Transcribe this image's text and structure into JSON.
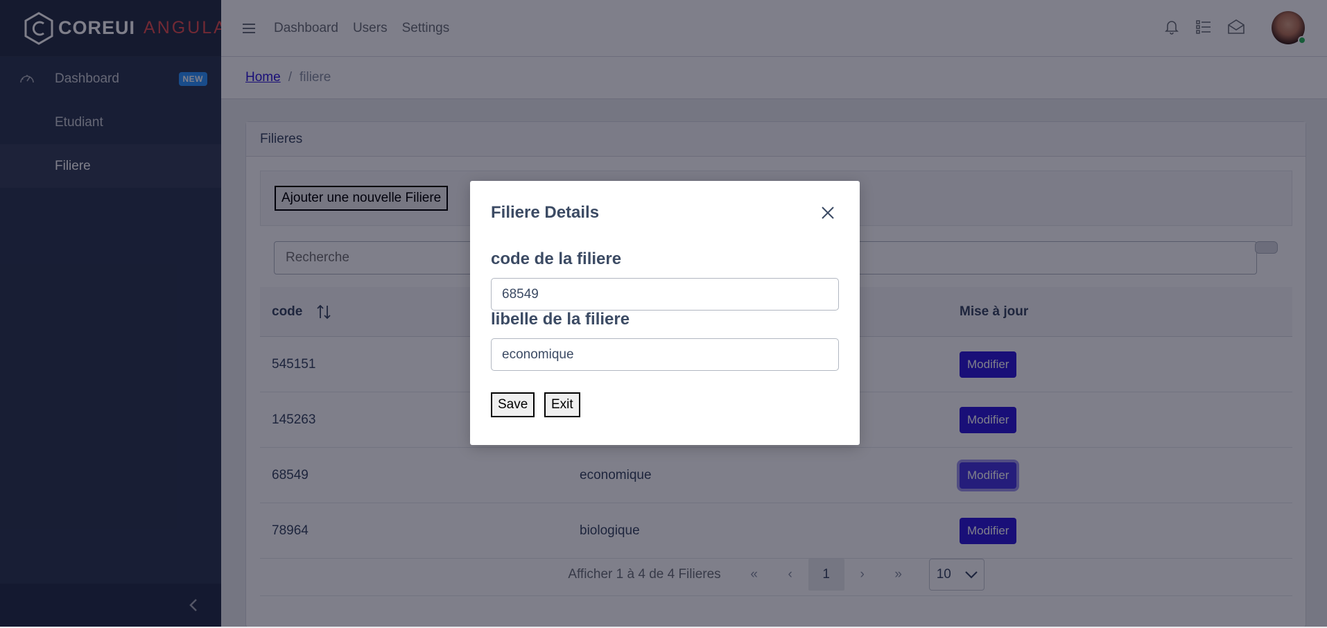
{
  "brand": {
    "part_a": "COREUI",
    "part_b": "ANGULAR"
  },
  "sidebar": {
    "items": [
      {
        "label": "Dashboard",
        "badge": "NEW",
        "icon": "speedometer-icon"
      },
      {
        "label": "Etudiant"
      },
      {
        "label": "Filiere",
        "active": true
      }
    ],
    "toggler_icon": "chevron-left-icon"
  },
  "header": {
    "nav": [
      "Dashboard",
      "Users",
      "Settings"
    ],
    "icons": [
      "bell-icon",
      "list-icon",
      "envelope-icon"
    ]
  },
  "breadcrumb": {
    "home": "Home",
    "separator": "/",
    "current": "filiere"
  },
  "card": {
    "title": "Filieres",
    "add_button": "Ajouter une nouvelle Filiere",
    "search_placeholder": "Recherche"
  },
  "table": {
    "columns": {
      "code": "code",
      "update": "Mise à jour"
    },
    "rows": [
      {
        "code": "545151",
        "libelle": "",
        "action": "Modifier"
      },
      {
        "code": "145263",
        "libelle": "",
        "action": "Modifier"
      },
      {
        "code": "68549",
        "libelle": "economique",
        "action": "Modifier"
      },
      {
        "code": "78964",
        "libelle": "biologique",
        "action": "Modifier"
      }
    ]
  },
  "pagination": {
    "summary": "Afficher 1 à 4 de 4 Filieres",
    "first": "«",
    "prev": "‹",
    "page": "1",
    "next": "›",
    "last": "»",
    "page_size": "10"
  },
  "modal": {
    "title": "Filiere Details",
    "code_label": "code de la filiere",
    "code_value": "68549",
    "libelle_label": "libelle de la filiere",
    "libelle_value": "economique",
    "save": "Save",
    "exit": "Exit"
  },
  "colors": {
    "primary": "#321fdb",
    "sidebar": "#303c54",
    "danger": "#e55353",
    "info": "#3399ff",
    "success": "#2eb85c"
  }
}
